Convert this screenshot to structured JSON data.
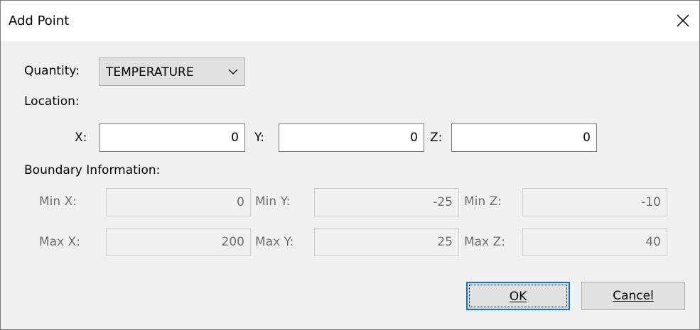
{
  "window": {
    "title": "Add Point"
  },
  "quantity": {
    "label": "Quantity:",
    "selected": "TEMPERATURE"
  },
  "location": {
    "heading": "Location:",
    "x": {
      "label": "X:",
      "value": "0"
    },
    "y": {
      "label": "Y:",
      "value": "0"
    },
    "z": {
      "label": "Z:",
      "value": "0"
    }
  },
  "boundary": {
    "heading": "Boundary Information:",
    "min_x": {
      "label": "Min X:",
      "value": "0"
    },
    "min_y": {
      "label": "Min Y:",
      "value": "-25"
    },
    "min_z": {
      "label": "Min Z:",
      "value": "-10"
    },
    "max_x": {
      "label": "Max X:",
      "value": "200"
    },
    "max_y": {
      "label": "Max Y:",
      "value": "25"
    },
    "max_z": {
      "label": "Max Z:",
      "value": "40"
    }
  },
  "buttons": {
    "ok": "OK",
    "cancel": "Cancel"
  },
  "icons": {
    "close": "close-icon",
    "dropdown": "chevron-down-icon"
  },
  "colors": {
    "accent": "#0078d7",
    "dialog_bg": "#f0f0f0"
  }
}
